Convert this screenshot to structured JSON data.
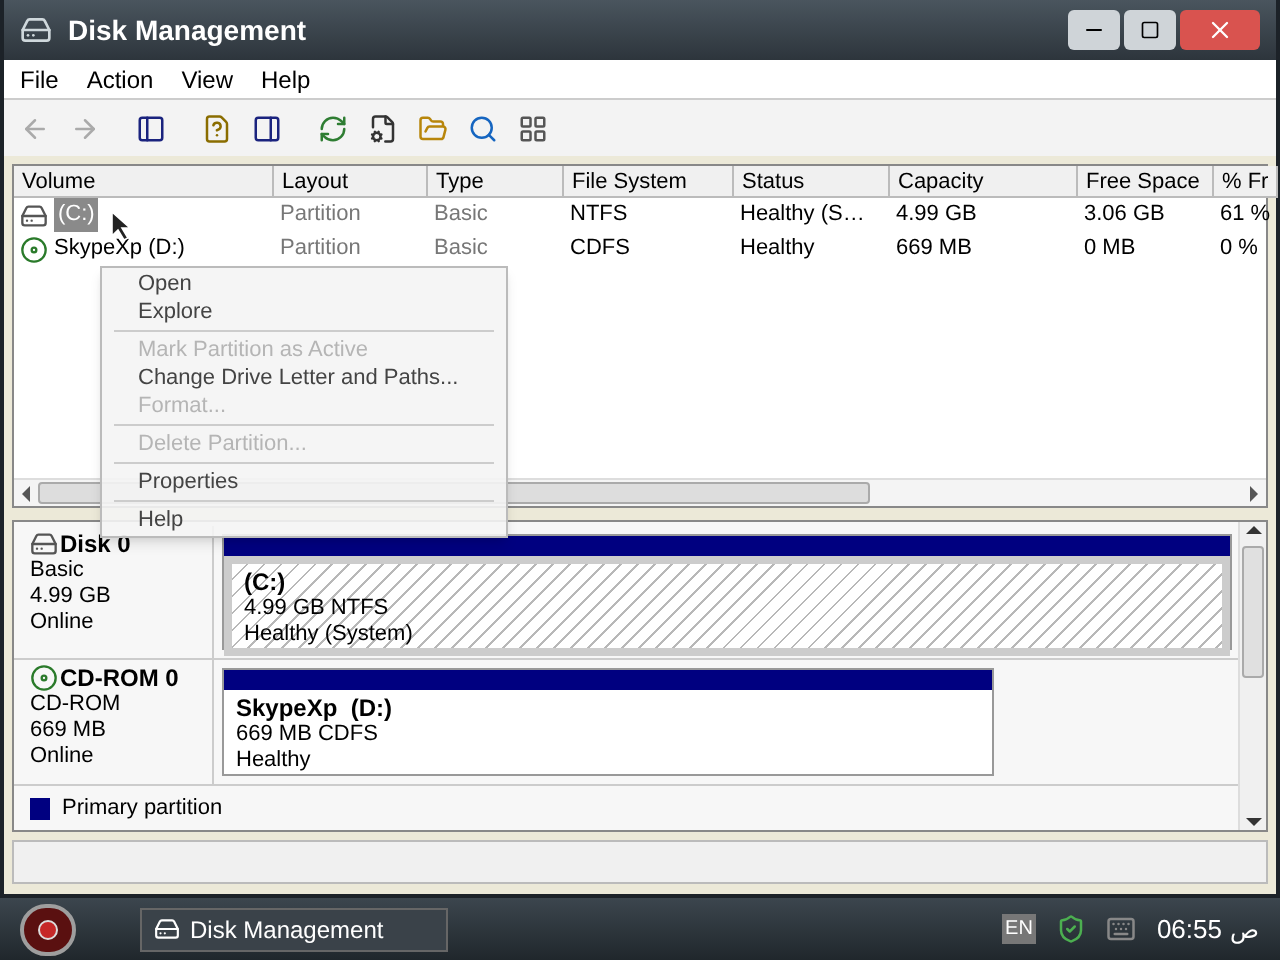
{
  "window": {
    "title": "Disk Management"
  },
  "menu_bar": [
    "File",
    "Action",
    "View",
    "Help"
  ],
  "volume_list": {
    "columns": [
      "Volume",
      "Layout",
      "Type",
      "File System",
      "Status",
      "Capacity",
      "Free Space",
      "% Fr"
    ],
    "rows": [
      {
        "selected": true,
        "kind": "disk",
        "cells": [
          "(C:)",
          "Partition",
          "Basic",
          "NTFS",
          "Healthy (S…",
          "4.99 GB",
          "3.06 GB",
          "61 %"
        ]
      },
      {
        "selected": false,
        "kind": "cdrom",
        "cells": [
          "SkypeXp (D:)",
          "Partition",
          "Basic",
          "CDFS",
          "Healthy",
          "669 MB",
          "0 MB",
          "0 %"
        ]
      }
    ]
  },
  "context_menu": [
    {
      "kind": "item",
      "label": "Open",
      "disabled": false
    },
    {
      "kind": "item",
      "label": "Explore",
      "disabled": false
    },
    {
      "kind": "separator"
    },
    {
      "kind": "item",
      "label": "Mark Partition as Active",
      "disabled": true
    },
    {
      "kind": "item",
      "label": "Change Drive Letter and Paths...",
      "disabled": false
    },
    {
      "kind": "item",
      "label": "Format...",
      "disabled": true
    },
    {
      "kind": "separator"
    },
    {
      "kind": "item",
      "label": "Delete Partition...",
      "disabled": true
    },
    {
      "kind": "separator"
    },
    {
      "kind": "item",
      "label": "Properties",
      "disabled": false
    },
    {
      "kind": "separator"
    },
    {
      "kind": "item",
      "label": "Help",
      "disabled": false
    }
  ],
  "disks": [
    {
      "kind": "disk",
      "name": "Disk 0",
      "lines": [
        "Basic",
        "4.99 GB",
        "Online"
      ],
      "partition": {
        "title": "(C:)",
        "lines": [
          "4.99 GB NTFS",
          "Healthy (System)"
        ],
        "hatched": true
      }
    },
    {
      "kind": "cdrom",
      "name": "CD-ROM 0",
      "lines": [
        "CD-ROM",
        "669 MB",
        "Online"
      ],
      "partition": {
        "title": "SkypeXp  (D:)",
        "lines": [
          "669 MB CDFS",
          "Healthy"
        ],
        "hatched": false
      }
    }
  ],
  "legend": [
    {
      "label": "Primary partition",
      "color": "#000080"
    }
  ],
  "taskbar": {
    "task": "Disk Management",
    "language": "EN",
    "time": "06:55",
    "period": "ص"
  }
}
